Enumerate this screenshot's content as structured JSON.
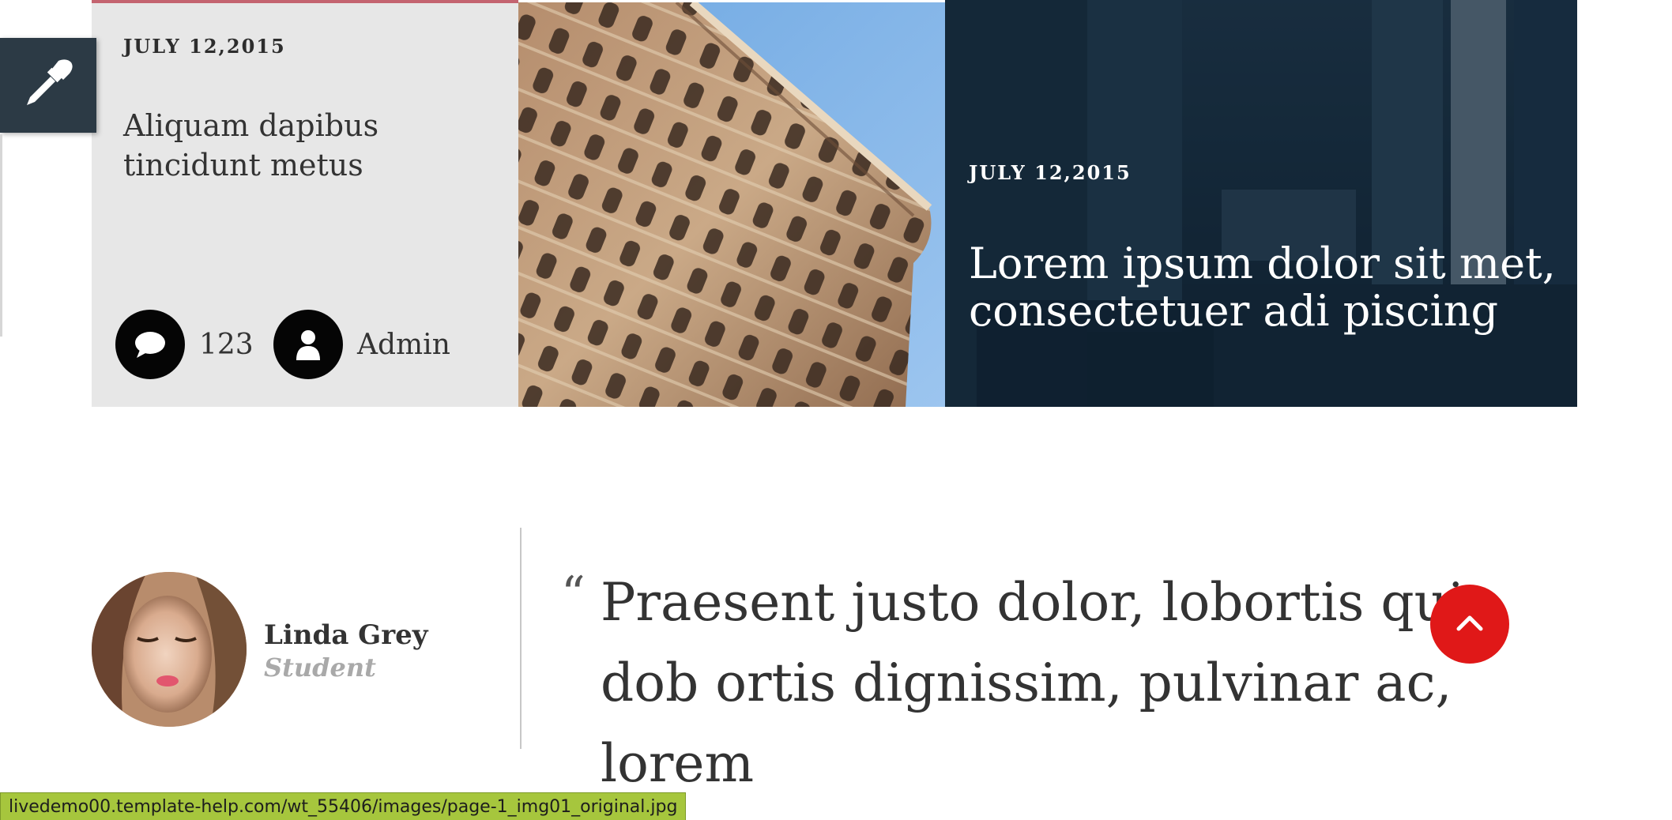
{
  "post_left": {
    "date": "JULY 12,2015",
    "title": "Aliquam dapibus tincidunt metus",
    "comments_count": "123",
    "author": "Admin"
  },
  "post_right": {
    "date": "JULY 12,2015",
    "title": "Lorem ipsum dolor sit met, consectetuer adi piscing"
  },
  "testimonial": {
    "name": "Linda Grey",
    "role": "Student",
    "quote_mark": "“",
    "quote": "Praesent justo dolor, lobortis quis dob ortis dignissim, pulvinar ac, lorem"
  },
  "status_bar": {
    "url": "livedemo00.template-help.com/wt_55406/images/page-1_img01_original.jpg"
  },
  "colors": {
    "accent_red": "#e01818",
    "card_grey": "#e7e7e7",
    "status_green": "#a6c63d"
  },
  "icons": {
    "tool": "eyedropper-icon",
    "comments": "speech-bubble-icon",
    "author": "user-icon",
    "back_to_top": "chevron-up-icon"
  }
}
